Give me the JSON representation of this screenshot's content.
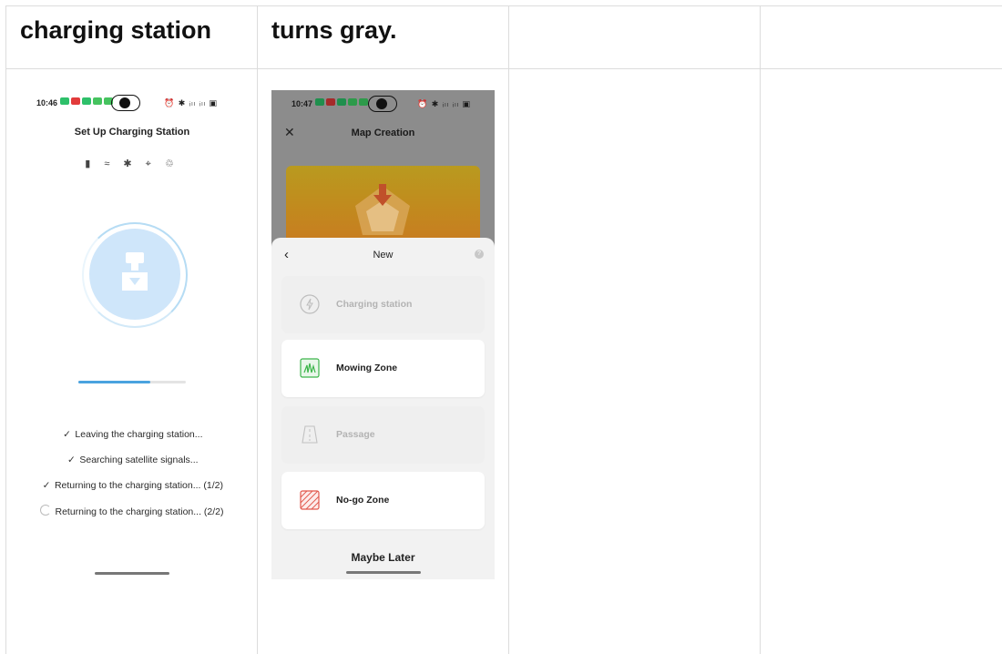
{
  "header": {
    "col1": "charging station",
    "col2": "turns gray."
  },
  "phone1": {
    "status_time": "10:46",
    "status_right": "⏰ ✱ ᵢₗₗ ᵢₗₗ ▣",
    "title": "Set Up Charging Station",
    "status_icons": "▮ ≈ ✱ ⌖ ♲",
    "progress_fraction": 0.67,
    "steps": [
      {
        "state": "done",
        "label": "Leaving the charging station..."
      },
      {
        "state": "done",
        "label": "Searching satellite signals..."
      },
      {
        "state": "done",
        "label": "Returning to the charging station... (1/2)"
      },
      {
        "state": "pending",
        "label": "Returning to the charging station... (2/2)"
      }
    ]
  },
  "phone2": {
    "status_time": "10:47",
    "status_right": "⏰ ✱ ᵢₗₗ ᵢₗₗ ▣",
    "close_glyph": "✕",
    "title": "Map Creation",
    "sheet": {
      "back_glyph": "‹",
      "title": "New",
      "help_glyph": "?",
      "options": [
        {
          "label": "Charging station",
          "state": "disabled",
          "icon": "lightning-icon"
        },
        {
          "label": "Mowing Zone",
          "state": "enabled",
          "icon": "grass-icon"
        },
        {
          "label": "Passage",
          "state": "disabled",
          "icon": "road-icon"
        },
        {
          "label": "No-go Zone",
          "state": "enabled",
          "icon": "no-go-hatch-icon"
        }
      ],
      "maybe_later": "Maybe Later"
    }
  },
  "colors": {
    "progress": "#4aa3df",
    "mowing_green": "#3cb54a",
    "nogo_red": "#e2574c",
    "disabled_text": "#b3b3b3"
  }
}
